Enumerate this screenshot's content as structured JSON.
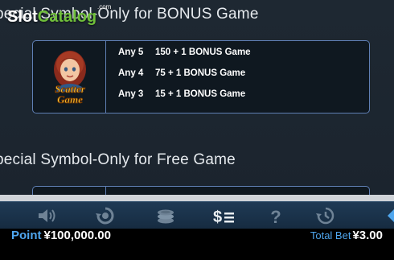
{
  "watermark": {
    "slot": "Slot",
    "catalog": "Catalog",
    "com": ".com"
  },
  "sections": [
    {
      "title": "pecial Symbol-Only for BONUS Game"
    },
    {
      "title": "pecial Symbol-Only for Free Game"
    }
  ],
  "scatter": {
    "icon_line1": "Scatter",
    "icon_line2": "Game",
    "payouts": [
      {
        "count": "Any 5",
        "award": "150 + 1 BONUS Game"
      },
      {
        "count": "Any 4",
        "award": "75 + 1 BONUS Game"
      },
      {
        "count": "Any 3",
        "award": "15 + 1 BONUS Game"
      }
    ]
  },
  "toolbar": {
    "icons": [
      "sound-icon",
      "autoplay-icon",
      "coins-icon",
      "paytable-icon",
      "help-icon",
      "history-icon",
      "next-arrow-icon"
    ],
    "colors": {
      "inactive": "#6f8396",
      "active": "#e9eef2",
      "accent": "#4fa6ee"
    }
  },
  "status": {
    "point_label": "Point",
    "point_value": "¥100,000.00",
    "totalbet_label": "Total Bet",
    "totalbet_value": "¥3.00"
  }
}
